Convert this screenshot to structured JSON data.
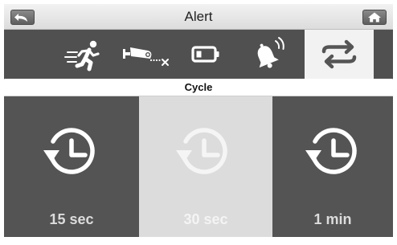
{
  "header": {
    "title": "Alert",
    "back_icon": "back-arrow-icon",
    "home_icon": "home-icon"
  },
  "tabs": [
    {
      "icon": "motion-running-person-icon",
      "selected": false
    },
    {
      "icon": "camera-out-of-range-icon",
      "selected": false
    },
    {
      "icon": "low-battery-icon",
      "selected": false
    },
    {
      "icon": "alarm-bell-icon",
      "selected": false
    },
    {
      "icon": "cycle-arrows-icon",
      "selected": true
    }
  ],
  "section": {
    "label": "Cycle"
  },
  "options": [
    {
      "label": "15 sec",
      "icon": "clock-history-icon",
      "selected": false
    },
    {
      "label": "30 sec",
      "icon": "clock-history-icon",
      "selected": true
    },
    {
      "label": "1 min",
      "icon": "clock-history-icon",
      "selected": false
    }
  ],
  "colors": {
    "tab_bar": "#505050",
    "tab_selected": "#f2f2f2",
    "option_tile": "#545454",
    "option_selected": "#dcdcdc"
  }
}
